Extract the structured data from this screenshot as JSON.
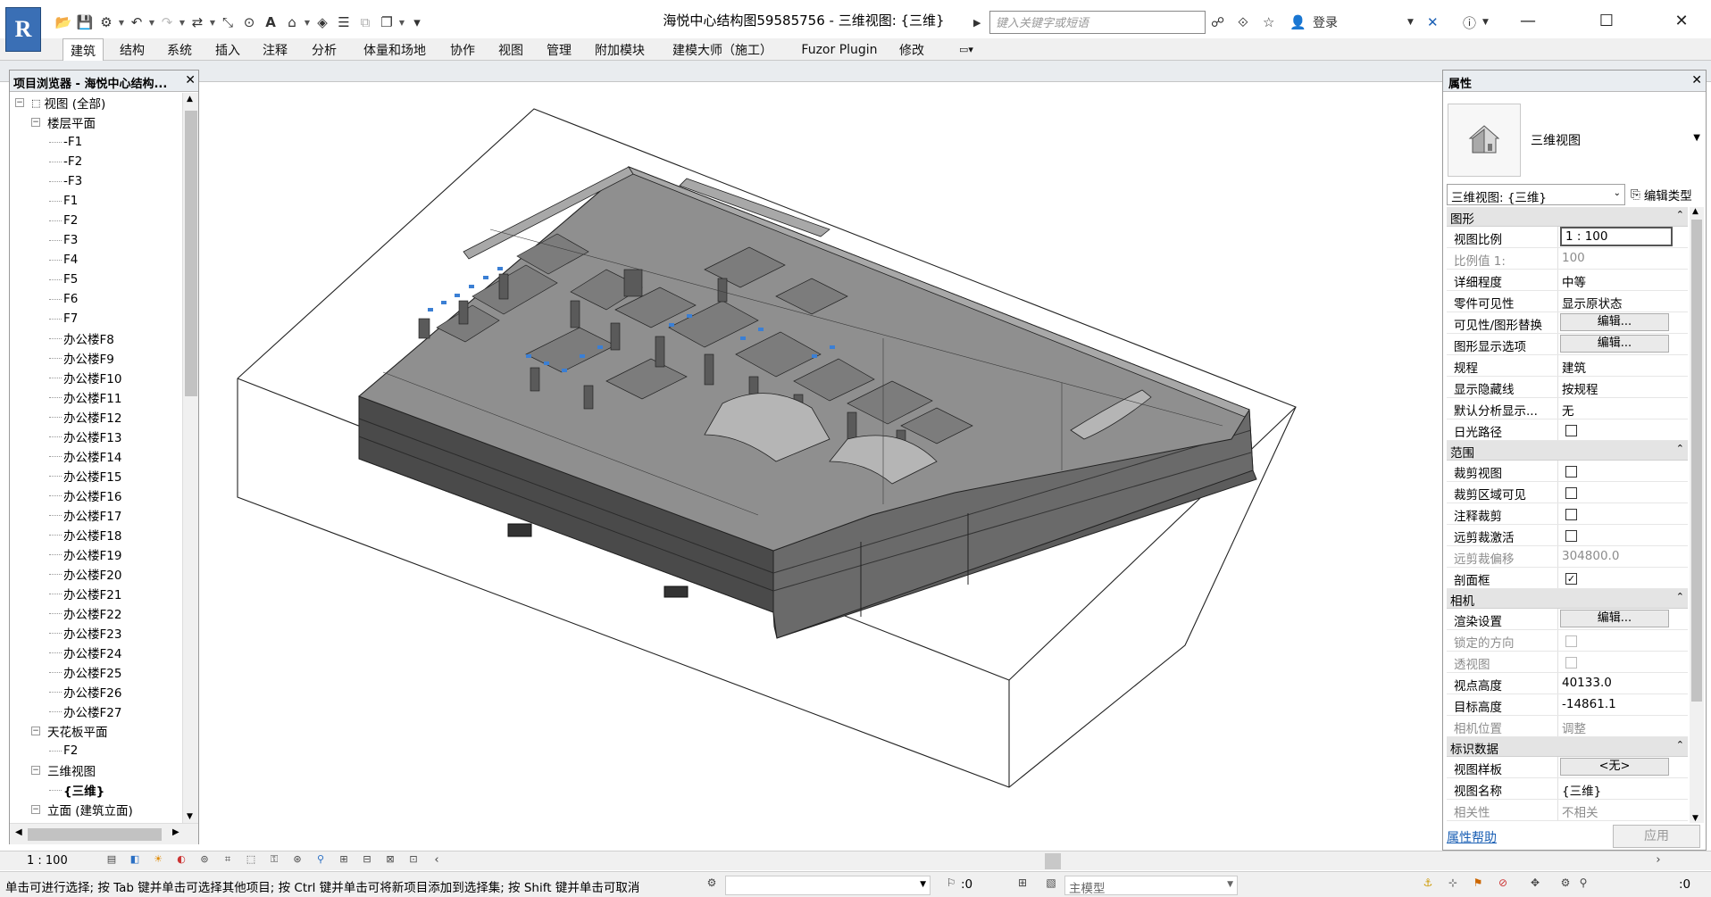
{
  "app": {
    "logo": "R",
    "title": "海悦中心结构图59585756 - 三维视图: {三维}"
  },
  "search": {
    "placeholder": "键入关键字或短语"
  },
  "user": {
    "login_label": "登录"
  },
  "ribbon_tabs": [
    "建筑",
    "结构",
    "系统",
    "插入",
    "注释",
    "分析",
    "体量和场地",
    "协作",
    "视图",
    "管理",
    "附加模块",
    "建模大师（施工）",
    "Fuzor Plugin",
    "修改"
  ],
  "browser": {
    "title": "项目浏览器 - 海悦中心结构...",
    "tree": [
      {
        "label": "视图 (全部)",
        "level": 0,
        "toggle": "⊟"
      },
      {
        "label": "楼层平面",
        "level": 1,
        "toggle": "⊟"
      },
      {
        "label": "-F1",
        "level": 2
      },
      {
        "label": "-F2",
        "level": 2
      },
      {
        "label": "-F3",
        "level": 2
      },
      {
        "label": "F1",
        "level": 2
      },
      {
        "label": "F2",
        "level": 2
      },
      {
        "label": "F3",
        "level": 2
      },
      {
        "label": "F4",
        "level": 2
      },
      {
        "label": "F5",
        "level": 2
      },
      {
        "label": "F6",
        "level": 2
      },
      {
        "label": "F7",
        "level": 2
      },
      {
        "label": "办公楼F8",
        "level": 2
      },
      {
        "label": "办公楼F9",
        "level": 2
      },
      {
        "label": "办公楼F10",
        "level": 2
      },
      {
        "label": "办公楼F11",
        "level": 2
      },
      {
        "label": "办公楼F12",
        "level": 2
      },
      {
        "label": "办公楼F13",
        "level": 2
      },
      {
        "label": "办公楼F14",
        "level": 2
      },
      {
        "label": "办公楼F15",
        "level": 2
      },
      {
        "label": "办公楼F16",
        "level": 2
      },
      {
        "label": "办公楼F17",
        "level": 2
      },
      {
        "label": "办公楼F18",
        "level": 2
      },
      {
        "label": "办公楼F19",
        "level": 2
      },
      {
        "label": "办公楼F20",
        "level": 2
      },
      {
        "label": "办公楼F21",
        "level": 2
      },
      {
        "label": "办公楼F22",
        "level": 2
      },
      {
        "label": "办公楼F23",
        "level": 2
      },
      {
        "label": "办公楼F24",
        "level": 2
      },
      {
        "label": "办公楼F25",
        "level": 2
      },
      {
        "label": "办公楼F26",
        "level": 2
      },
      {
        "label": "办公楼F27",
        "level": 2
      },
      {
        "label": "天花板平面",
        "level": 1,
        "toggle": "⊟"
      },
      {
        "label": "F2",
        "level": 2
      },
      {
        "label": "三维视图",
        "level": 1,
        "toggle": "⊟"
      },
      {
        "label": "{三维}",
        "level": 2,
        "bold": true
      },
      {
        "label": "立面 (建筑立面)",
        "level": 1,
        "toggle": "⊟"
      }
    ]
  },
  "properties": {
    "title": "属性",
    "type_name": "三维视图",
    "view_selector": "三维视图: {三维}",
    "edit_type_label": "编辑类型",
    "help_label": "属性帮助",
    "apply_label": "应用",
    "sections": [
      {
        "name": "图形",
        "rows": [
          {
            "name": "视图比例",
            "value": "1 : 100",
            "kind": "input"
          },
          {
            "name": "比例值 1:",
            "value": "100",
            "disabled": true
          },
          {
            "name": "详细程度",
            "value": "中等"
          },
          {
            "name": "零件可见性",
            "value": "显示原状态"
          },
          {
            "name": "可见性/图形替换",
            "value": "编辑...",
            "kind": "button"
          },
          {
            "name": "图形显示选项",
            "value": "编辑...",
            "kind": "button"
          },
          {
            "name": "规程",
            "value": "建筑"
          },
          {
            "name": "显示隐藏线",
            "value": "按规程"
          },
          {
            "name": "默认分析显示...",
            "value": "无"
          },
          {
            "name": "日光路径",
            "value": "",
            "kind": "check",
            "checked": false
          }
        ]
      },
      {
        "name": "范围",
        "rows": [
          {
            "name": "裁剪视图",
            "value": "",
            "kind": "check",
            "checked": false
          },
          {
            "name": "裁剪区域可见",
            "value": "",
            "kind": "check",
            "checked": false
          },
          {
            "name": "注释裁剪",
            "value": "",
            "kind": "check",
            "checked": false
          },
          {
            "name": "远剪裁激活",
            "value": "",
            "kind": "check",
            "checked": false
          },
          {
            "name": "远剪裁偏移",
            "value": "304800.0",
            "disabled": true
          },
          {
            "name": "剖面框",
            "value": "",
            "kind": "check",
            "checked": true
          }
        ]
      },
      {
        "name": "相机",
        "rows": [
          {
            "name": "渲染设置",
            "value": "编辑...",
            "kind": "button"
          },
          {
            "name": "锁定的方向",
            "value": "",
            "kind": "check",
            "checked": false,
            "disabled": true
          },
          {
            "name": "透视图",
            "value": "",
            "kind": "check",
            "checked": false,
            "disabled": true
          },
          {
            "name": "视点高度",
            "value": "40133.0"
          },
          {
            "name": "目标高度",
            "value": "-14861.1"
          },
          {
            "name": "相机位置",
            "value": "调整",
            "disabled": true
          }
        ]
      },
      {
        "name": "标识数据",
        "rows": [
          {
            "name": "视图样板",
            "value": "<无>",
            "kind": "button"
          },
          {
            "name": "视图名称",
            "value": "{三维}"
          },
          {
            "name": "相关性",
            "value": "不相关",
            "disabled": true
          }
        ]
      }
    ]
  },
  "view_control": {
    "scale": "1 : 100"
  },
  "status": {
    "text": "单击可进行选择; 按 Tab 键并单击可选择其他项目; 按 Ctrl 键并单击可将新项目添加到选择集; 按 Shift 键并单击可取消",
    "select_count": ":0",
    "model_label": "主模型",
    "filter_count": ":0"
  },
  "colors": {
    "ribbon_bg": "#f0f0f0",
    "accent": "#3a6fb5",
    "model_gray": "#9a9a9a",
    "model_dark": "#555555"
  }
}
